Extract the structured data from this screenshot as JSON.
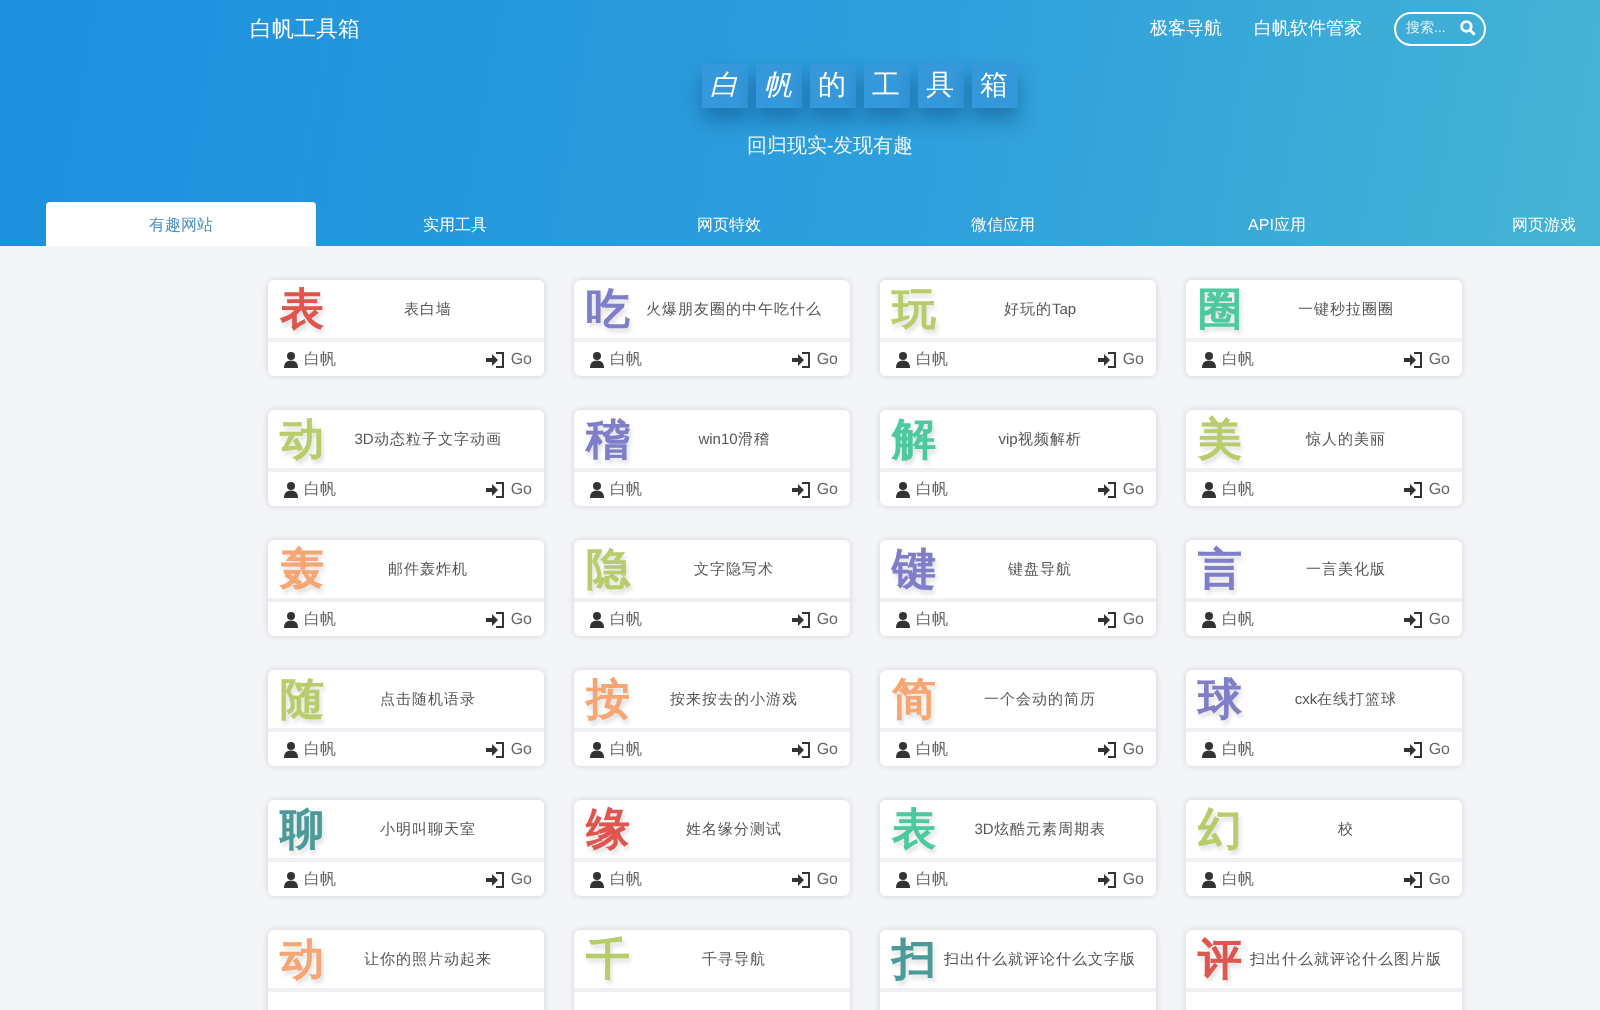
{
  "header": {
    "site_title": "白帆工具箱",
    "nav_links": [
      "极客导航",
      "白帆软件管家"
    ],
    "search": {
      "placeholder": "搜索..."
    }
  },
  "banner": {
    "title_chars": [
      "白",
      "帆",
      "的",
      "工",
      "具",
      "箱"
    ],
    "subtitle": "回归现实-发现有趣"
  },
  "tabs": [
    {
      "label": "有趣网站",
      "selected": true
    },
    {
      "label": "实用工具",
      "selected": false
    },
    {
      "label": "网页特效",
      "selected": false
    },
    {
      "label": "微信应用",
      "selected": false
    },
    {
      "label": "API应用",
      "selected": false
    },
    {
      "label": "网页游戏",
      "selected": false
    }
  ],
  "cards": [
    {
      "glyph": "表",
      "color": "#e0554e",
      "description": "表白墙",
      "author": "白帆",
      "action": "Go"
    },
    {
      "glyph": "吃",
      "color": "#7f7fc9",
      "description": "火爆朋友圈的中午吃什么",
      "author": "白帆",
      "action": "Go"
    },
    {
      "glyph": "玩",
      "color": "#b8cc6a",
      "description": "好玩的Tap",
      "author": "白帆",
      "action": "Go"
    },
    {
      "glyph": "圈",
      "color": "#4dc9a0",
      "description": "一键秒拉圈圈",
      "author": "白帆",
      "action": "Go"
    },
    {
      "glyph": "动",
      "color": "#b8cc6a",
      "description": "3D动态粒子文字动画",
      "author": "白帆",
      "action": "Go"
    },
    {
      "glyph": "稽",
      "color": "#7f7fc9",
      "description": "win10滑稽",
      "author": "白帆",
      "action": "Go"
    },
    {
      "glyph": "解",
      "color": "#4dc9a0",
      "description": "vip视频解析",
      "author": "白帆",
      "action": "Go"
    },
    {
      "glyph": "美",
      "color": "#b8cc6a",
      "description": "惊人的美丽",
      "author": "白帆",
      "action": "Go"
    },
    {
      "glyph": "轰",
      "color": "#f5a673",
      "description": "邮件轰炸机",
      "author": "白帆",
      "action": "Go"
    },
    {
      "glyph": "隐",
      "color": "#b8cc6a",
      "description": "文字隐写术",
      "author": "白帆",
      "action": "Go"
    },
    {
      "glyph": "键",
      "color": "#7f7fc9",
      "description": "键盘导航",
      "author": "白帆",
      "action": "Go"
    },
    {
      "glyph": "言",
      "color": "#7f7fc9",
      "description": "一言美化版",
      "author": "白帆",
      "action": "Go"
    },
    {
      "glyph": "随",
      "color": "#b8cc6a",
      "description": "点击随机语录",
      "author": "白帆",
      "action": "Go"
    },
    {
      "glyph": "按",
      "color": "#f5a673",
      "description": "按来按去的小游戏",
      "author": "白帆",
      "action": "Go"
    },
    {
      "glyph": "简",
      "color": "#f5a673",
      "description": "一个会动的简历",
      "author": "白帆",
      "action": "Go"
    },
    {
      "glyph": "球",
      "color": "#7f7fc9",
      "description": "cxk在线打篮球",
      "author": "白帆",
      "action": "Go"
    },
    {
      "glyph": "聊",
      "color": "#4b9a9a",
      "description": "小明叫聊天室",
      "author": "白帆",
      "action": "Go"
    },
    {
      "glyph": "缘",
      "color": "#e0554e",
      "description": "姓名缘分测试",
      "author": "白帆",
      "action": "Go"
    },
    {
      "glyph": "表",
      "color": "#4dc9a0",
      "description": "3D炫酷元素周期表",
      "author": "白帆",
      "action": "Go"
    },
    {
      "glyph": "幻",
      "color": "#b8cc6a",
      "description": "校",
      "author": "白帆",
      "action": "Go"
    },
    {
      "glyph": "动",
      "color": "#f5a673",
      "description": "让你的照片动起来"
    },
    {
      "glyph": "千",
      "color": "#b8cc6a",
      "description": "千寻导航"
    },
    {
      "glyph": "扫",
      "color": "#4b9a9a",
      "description": "扫出什么就评论什么文字版"
    },
    {
      "glyph": "评",
      "color": "#e0554e",
      "description": "扫出什么就评论什么图片版"
    }
  ]
}
